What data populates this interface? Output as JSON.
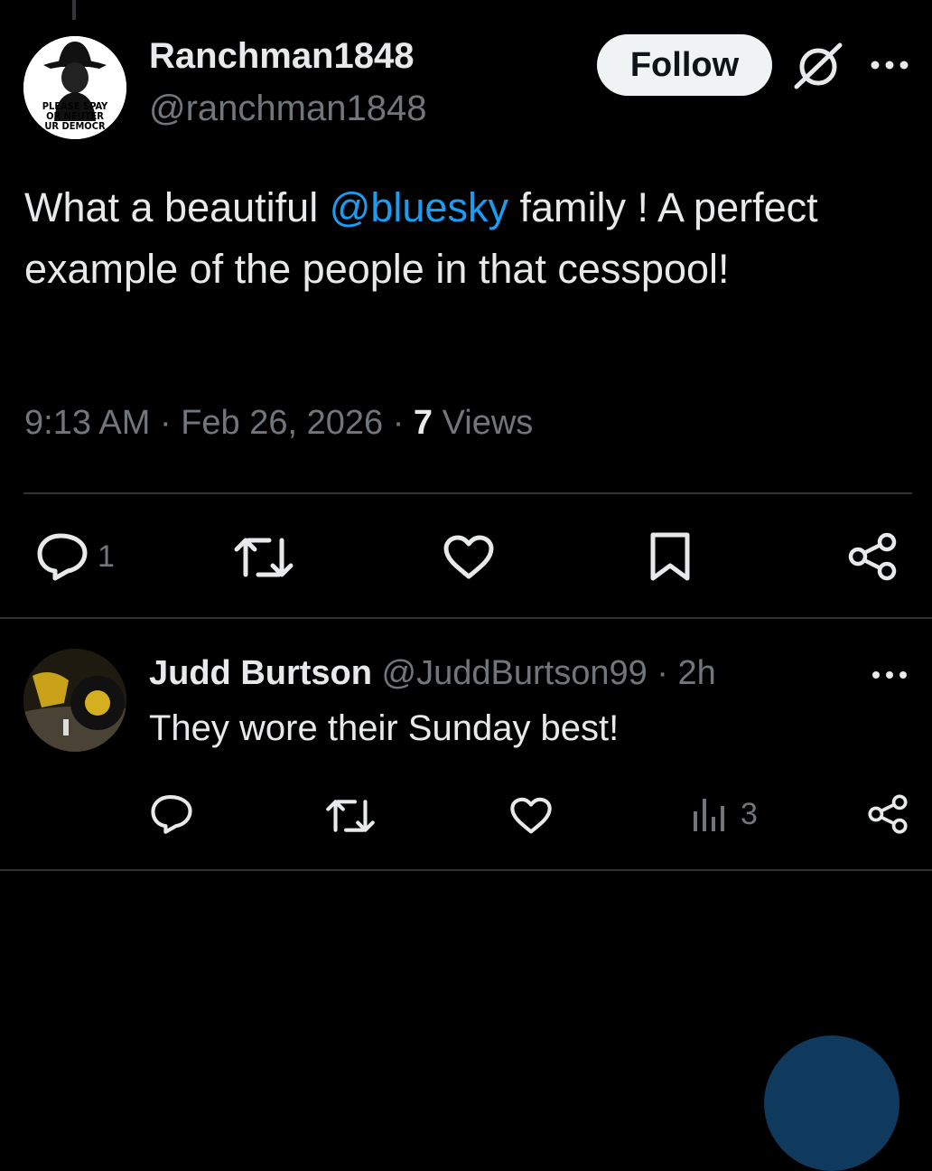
{
  "post": {
    "author": {
      "display_name": "Ranchman1848",
      "handle": "@ranchman1848",
      "avatar_text_line1": "PLEASE SPAY",
      "avatar_text_line2": "OR NEUTER",
      "avatar_text_line3": "UR DEMOCR"
    },
    "follow_label": "Follow",
    "text_before": "What a beautiful ",
    "mention": "@bluesky",
    "text_after": "  family !  A perfect example of the people in that cesspool!",
    "timestamp": "9:13 AM · Feb 26, 2026 · ",
    "views_count": "7",
    "views_label": " Views",
    "actions": {
      "reply_count": "1"
    }
  },
  "reply": {
    "display_name": "Judd Burtson",
    "handle": " @JuddBurtson99 · 2h",
    "text": "They wore their Sunday best!",
    "actions": {
      "views_count": "3"
    }
  },
  "colors": {
    "background": "#000000",
    "text": "#e7e9ea",
    "muted": "#71767b",
    "accent": "#1d9bf0",
    "divider": "#2f3336"
  },
  "icons": [
    "grok-icon",
    "more-icon",
    "reply-icon",
    "repost-icon",
    "like-icon",
    "bookmark-icon",
    "share-icon",
    "views-icon"
  ]
}
